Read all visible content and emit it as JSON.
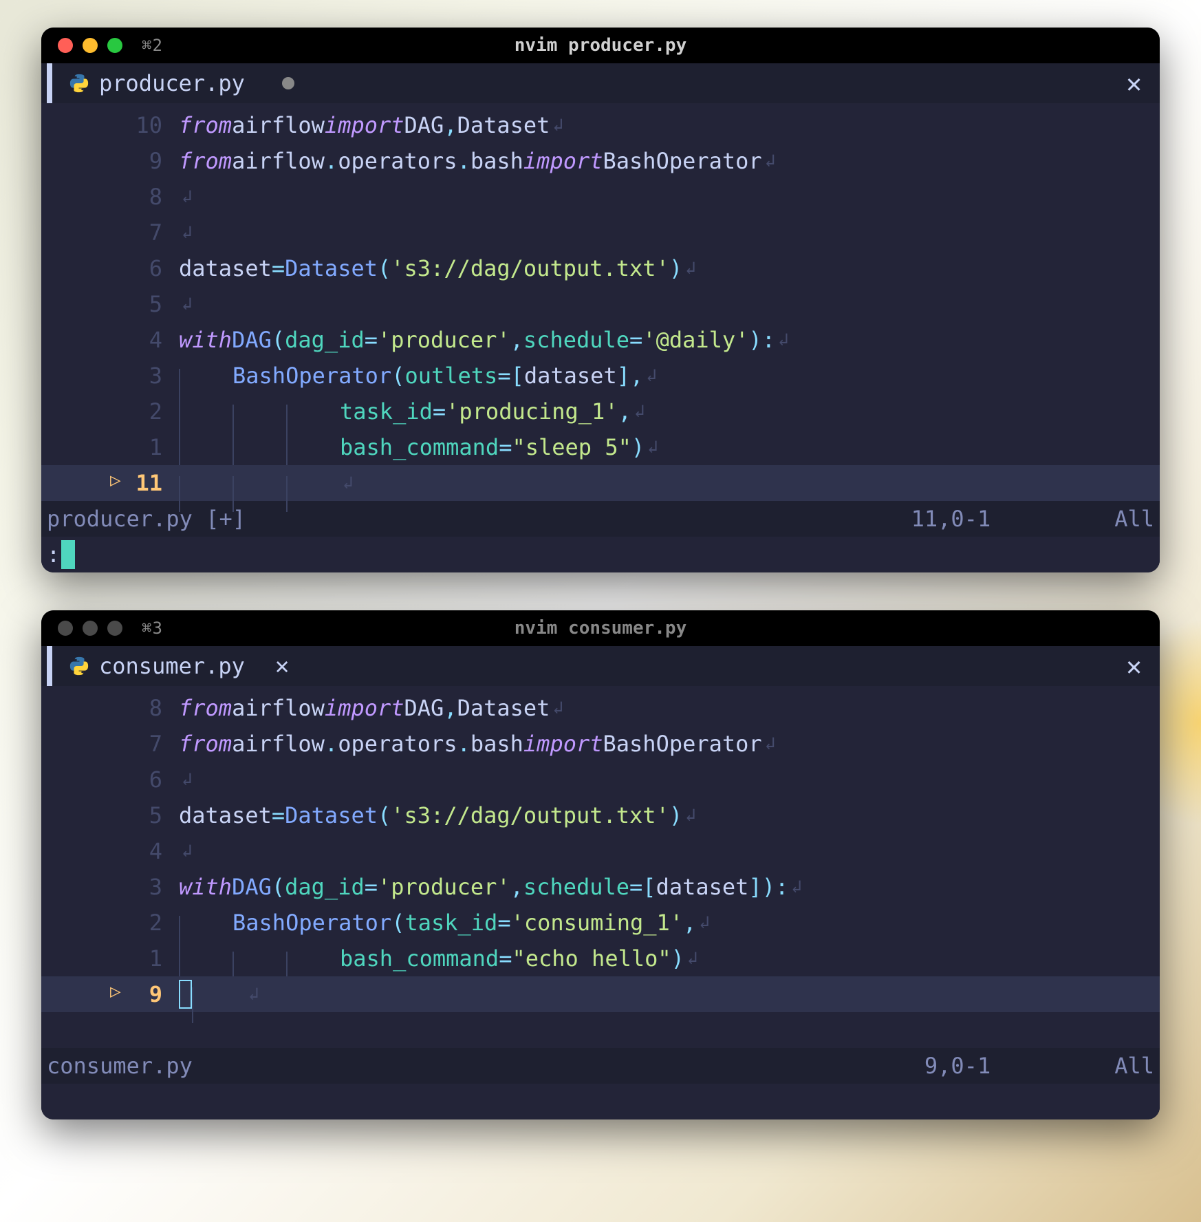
{
  "windows": [
    {
      "active": true,
      "tab_shortcut": "⌘2",
      "title": "nvim producer.py",
      "tab": {
        "filename": "producer.py",
        "modified": true
      },
      "status": {
        "file": "producer.py [+]",
        "position": "11,0-1",
        "scroll": "All"
      },
      "cmdline_prefix": ":",
      "current_line": "11",
      "lines": [
        {
          "rel": "10",
          "tokens": [
            [
              "kw",
              "from"
            ],
            [
              "",
              ""
            ],
            [
              "ident",
              "airflow"
            ],
            [
              "",
              ""
            ],
            [
              "kw",
              "import"
            ],
            [
              "",
              ""
            ],
            [
              "cls",
              "DAG"
            ],
            [
              "op",
              ","
            ],
            [
              "",
              ""
            ],
            [
              "ident",
              "Dataset"
            ]
          ]
        },
        {
          "rel": "9",
          "tokens": [
            [
              "kw",
              "from"
            ],
            [
              "",
              ""
            ],
            [
              "ident",
              "airflow"
            ],
            [
              "op",
              "."
            ],
            [
              "ident",
              "operators"
            ],
            [
              "op",
              "."
            ],
            [
              "ident",
              "bash"
            ],
            [
              "",
              ""
            ],
            [
              "kw",
              "import"
            ],
            [
              "",
              ""
            ],
            [
              "ident",
              "BashOperator"
            ]
          ]
        },
        {
          "rel": "8",
          "tokens": []
        },
        {
          "rel": "7",
          "tokens": []
        },
        {
          "rel": "6",
          "tokens": [
            [
              "ident",
              "dataset"
            ],
            [
              "",
              ""
            ],
            [
              "op",
              "="
            ],
            [
              "",
              ""
            ],
            [
              "fn",
              "Dataset"
            ],
            [
              "op",
              "("
            ],
            [
              "str",
              "'s3://dag/output.txt'"
            ],
            [
              "op",
              ")"
            ]
          ]
        },
        {
          "rel": "5",
          "tokens": []
        },
        {
          "rel": "4",
          "tokens": [
            [
              "kw",
              "with"
            ],
            [
              "",
              ""
            ],
            [
              "fn",
              "DAG"
            ],
            [
              "op",
              "("
            ],
            [
              "paramname",
              "dag_id"
            ],
            [
              "op",
              "="
            ],
            [
              "str",
              "'producer'"
            ],
            [
              "op",
              ","
            ],
            [
              "",
              ""
            ],
            [
              "paramname",
              "schedule"
            ],
            [
              "op",
              "="
            ],
            [
              "str",
              "'@daily'"
            ],
            [
              "op",
              ")"
            ],
            [
              "op",
              ":"
            ]
          ]
        },
        {
          "rel": "3",
          "indent": 1,
          "tokens": [
            [
              "fn",
              "BashOperator"
            ],
            [
              "op",
              "("
            ],
            [
              "paramname",
              "outlets"
            ],
            [
              "op",
              "="
            ],
            [
              "op",
              "["
            ],
            [
              "ident",
              "dataset"
            ],
            [
              "op",
              "]"
            ],
            [
              "op",
              ","
            ]
          ]
        },
        {
          "rel": "2",
          "indent": 3,
          "align": "             ",
          "tokens": [
            [
              "paramname",
              "task_id"
            ],
            [
              "op",
              "="
            ],
            [
              "str",
              "'producing_1'"
            ],
            [
              "op",
              ","
            ]
          ]
        },
        {
          "rel": "1",
          "indent": 3,
          "align": "             ",
          "tokens": [
            [
              "paramname",
              "bash_command"
            ],
            [
              "op",
              "="
            ],
            [
              "str",
              "\"sleep 5\""
            ],
            [
              "op",
              ")"
            ]
          ]
        }
      ]
    },
    {
      "active": false,
      "tab_shortcut": "⌘3",
      "title": "nvim consumer.py",
      "tab": {
        "filename": "consumer.py",
        "modified": false
      },
      "status": {
        "file": "consumer.py",
        "position": "9,0-1",
        "scroll": "All"
      },
      "cmdline_prefix": "",
      "current_line": "9",
      "lines": [
        {
          "rel": "8",
          "tokens": [
            [
              "kw",
              "from"
            ],
            [
              "",
              ""
            ],
            [
              "ident",
              "airflow"
            ],
            [
              "",
              ""
            ],
            [
              "kw",
              "import"
            ],
            [
              "",
              ""
            ],
            [
              "cls",
              "DAG"
            ],
            [
              "op",
              ","
            ],
            [
              "",
              ""
            ],
            [
              "ident",
              "Dataset"
            ]
          ]
        },
        {
          "rel": "7",
          "tokens": [
            [
              "kw",
              "from"
            ],
            [
              "",
              ""
            ],
            [
              "ident",
              "airflow"
            ],
            [
              "op",
              "."
            ],
            [
              "ident",
              "operators"
            ],
            [
              "op",
              "."
            ],
            [
              "ident",
              "bash"
            ],
            [
              "",
              ""
            ],
            [
              "kw",
              "import"
            ],
            [
              "",
              ""
            ],
            [
              "ident",
              "BashOperator"
            ]
          ]
        },
        {
          "rel": "6",
          "tokens": []
        },
        {
          "rel": "5",
          "tokens": [
            [
              "ident",
              "dataset"
            ],
            [
              "",
              ""
            ],
            [
              "op",
              "="
            ],
            [
              "",
              ""
            ],
            [
              "fn",
              "Dataset"
            ],
            [
              "op",
              "("
            ],
            [
              "str",
              "'s3://dag/output.txt'"
            ],
            [
              "op",
              ")"
            ]
          ]
        },
        {
          "rel": "4",
          "tokens": []
        },
        {
          "rel": "3",
          "tokens": [
            [
              "kw",
              "with"
            ],
            [
              "",
              ""
            ],
            [
              "fn",
              "DAG"
            ],
            [
              "op",
              "("
            ],
            [
              "paramname",
              "dag_id"
            ],
            [
              "op",
              "="
            ],
            [
              "str",
              "'producer'"
            ],
            [
              "op",
              ","
            ],
            [
              "",
              ""
            ],
            [
              "paramname",
              "schedule"
            ],
            [
              "op",
              "="
            ],
            [
              "op",
              "["
            ],
            [
              "ident",
              "dataset"
            ],
            [
              "op",
              "]"
            ],
            [
              "op",
              ")"
            ],
            [
              "op",
              ":"
            ]
          ]
        },
        {
          "rel": "2",
          "indent": 1,
          "tokens": [
            [
              "fn",
              "BashOperator"
            ],
            [
              "op",
              "("
            ],
            [
              "paramname",
              "task_id"
            ],
            [
              "op",
              "="
            ],
            [
              "str",
              "'consuming_1'"
            ],
            [
              "op",
              ","
            ]
          ]
        },
        {
          "rel": "1",
          "indent": 3,
          "align": "             ",
          "tokens": [
            [
              "paramname",
              "bash_command"
            ],
            [
              "op",
              "="
            ],
            [
              "str",
              "\"echo hello\""
            ],
            [
              "op",
              ")"
            ]
          ]
        }
      ]
    }
  ]
}
